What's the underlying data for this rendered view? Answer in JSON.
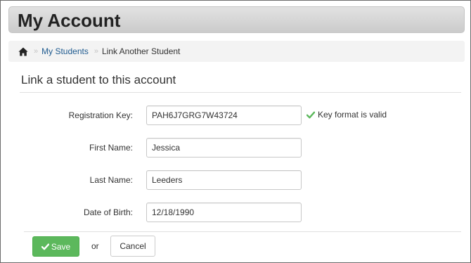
{
  "header": {
    "title": "My Account"
  },
  "breadcrumb": {
    "home_icon": "home-icon",
    "separator": "»",
    "items": [
      {
        "label": "My Students",
        "link": true
      },
      {
        "label": "Link Another Student",
        "link": false
      }
    ]
  },
  "section": {
    "title": "Link a student to this account"
  },
  "form": {
    "fields": [
      {
        "label": "Registration Key:",
        "value": "PAH6J7GRG7W43724"
      },
      {
        "label": "First Name:",
        "value": "Jessica"
      },
      {
        "label": "Last Name:",
        "value": "Leeders"
      },
      {
        "label": "Date of Birth:",
        "value": "12/18/1990"
      }
    ],
    "validation": {
      "icon": "check-icon",
      "text": "Key format is valid",
      "color": "#5cb85c"
    }
  },
  "actions": {
    "save_label": "Save",
    "save_icon": "check-icon",
    "or_label": "or",
    "cancel_label": "Cancel",
    "save_color": "#5cb85c"
  }
}
